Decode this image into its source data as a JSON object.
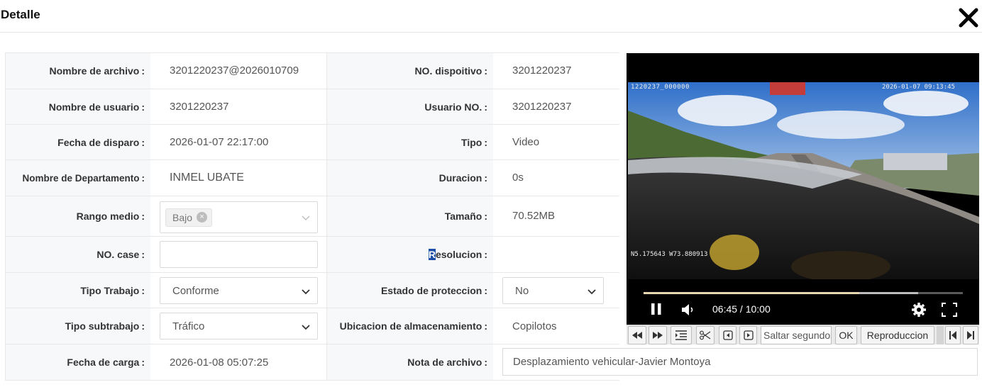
{
  "dialog": {
    "title": "Detalle",
    "close_icon": "close-icon"
  },
  "form": {
    "file_name": {
      "label": "Nombre de archivo",
      "value": "3201220237@2026010709"
    },
    "device_no": {
      "label": "NO. dispoitivo",
      "value": "3201220237"
    },
    "user_name": {
      "label": "Nombre de usuario",
      "value": "3201220237"
    },
    "user_no": {
      "label": "Usuario NO.",
      "value": "3201220237"
    },
    "trigger_date": {
      "label": "Fecha de disparo",
      "value": "2026-01-07 22:17:00"
    },
    "type": {
      "label": "Tipo",
      "value": "Video"
    },
    "department": {
      "label": "Nombre de Departamento",
      "value": "INMEL UBATE"
    },
    "duration": {
      "label": "Duracion",
      "value": "0s"
    },
    "range": {
      "label": "Rango medio",
      "tag": "Bajo"
    },
    "size": {
      "label": "Tamaño",
      "value": "70.52MB"
    },
    "case_no": {
      "label": "NO. case",
      "value": ""
    },
    "resolution": {
      "label_first": "R",
      "label_rest": "esolucion",
      "value": ""
    },
    "work_type": {
      "label": "Tipo Trabajo",
      "value": "Conforme"
    },
    "protection": {
      "label": "Estado de proteccion",
      "value": "No"
    },
    "work_subtype": {
      "label": "Tipo subtrabajo",
      "value": "Tráfico"
    },
    "storage": {
      "label": "Ubicacion de almacenamiento",
      "value": "Copilotos"
    },
    "upload_date": {
      "label": "Fecha de carga",
      "value": "2026-01-08 05:07:25"
    },
    "note": {
      "label": "Nota de archivo",
      "value": "Desplazamiento vehicular-Javier Montoya"
    },
    "colon": ":"
  },
  "video": {
    "osd_top_left": "1220237_000000",
    "osd_top_right": "2026-01-07 09:13:45",
    "osd_gps": "N5.175643 W73.880913",
    "time": "06:45 / 10:00",
    "progress": 0.675,
    "buffered": 0.86
  },
  "toolbar": {
    "seek_placeholder": "Saltar segundos",
    "ok_label": "OK",
    "playback_label": "Reproduccion"
  },
  "colors": {
    "accent": "#1d4fa8",
    "label_bg": "#f7f8fa"
  }
}
